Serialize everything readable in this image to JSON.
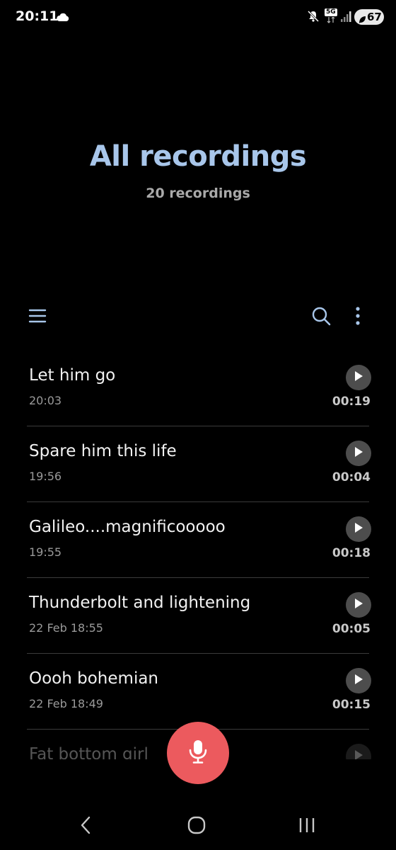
{
  "status_bar": {
    "time": "20:11",
    "network_label": "5G",
    "battery": "67",
    "icons": [
      "cloud-icon",
      "mute-icon",
      "signal-icon",
      "battery-icon"
    ]
  },
  "header": {
    "title": "All recordings",
    "subtitle": "20 recordings",
    "accent_color": "#a8c6ea"
  },
  "toolbar": {
    "icons": [
      "menu-icon",
      "search-icon",
      "more-options-icon"
    ]
  },
  "recordings": [
    {
      "title": "Let him go",
      "time": "20:03",
      "duration": "00:19"
    },
    {
      "title": "Spare him this life",
      "time": "19:56",
      "duration": "00:04"
    },
    {
      "title": "Galileo....magnificooooo",
      "time": "19:55",
      "duration": "00:18"
    },
    {
      "title": "Thunderbolt and lightening",
      "time": "22 Feb 18:55",
      "duration": "00:05"
    },
    {
      "title": "Oooh bohemian",
      "time": "22 Feb 18:49",
      "duration": "00:15"
    },
    {
      "title": "Fat bottom girl",
      "time": "",
      "duration": ""
    }
  ],
  "record_button": {
    "icon": "microphone-icon",
    "color": "#ec5a5e"
  },
  "nav_bar": {
    "icons": [
      "back-icon",
      "home-icon",
      "recents-icon"
    ]
  }
}
